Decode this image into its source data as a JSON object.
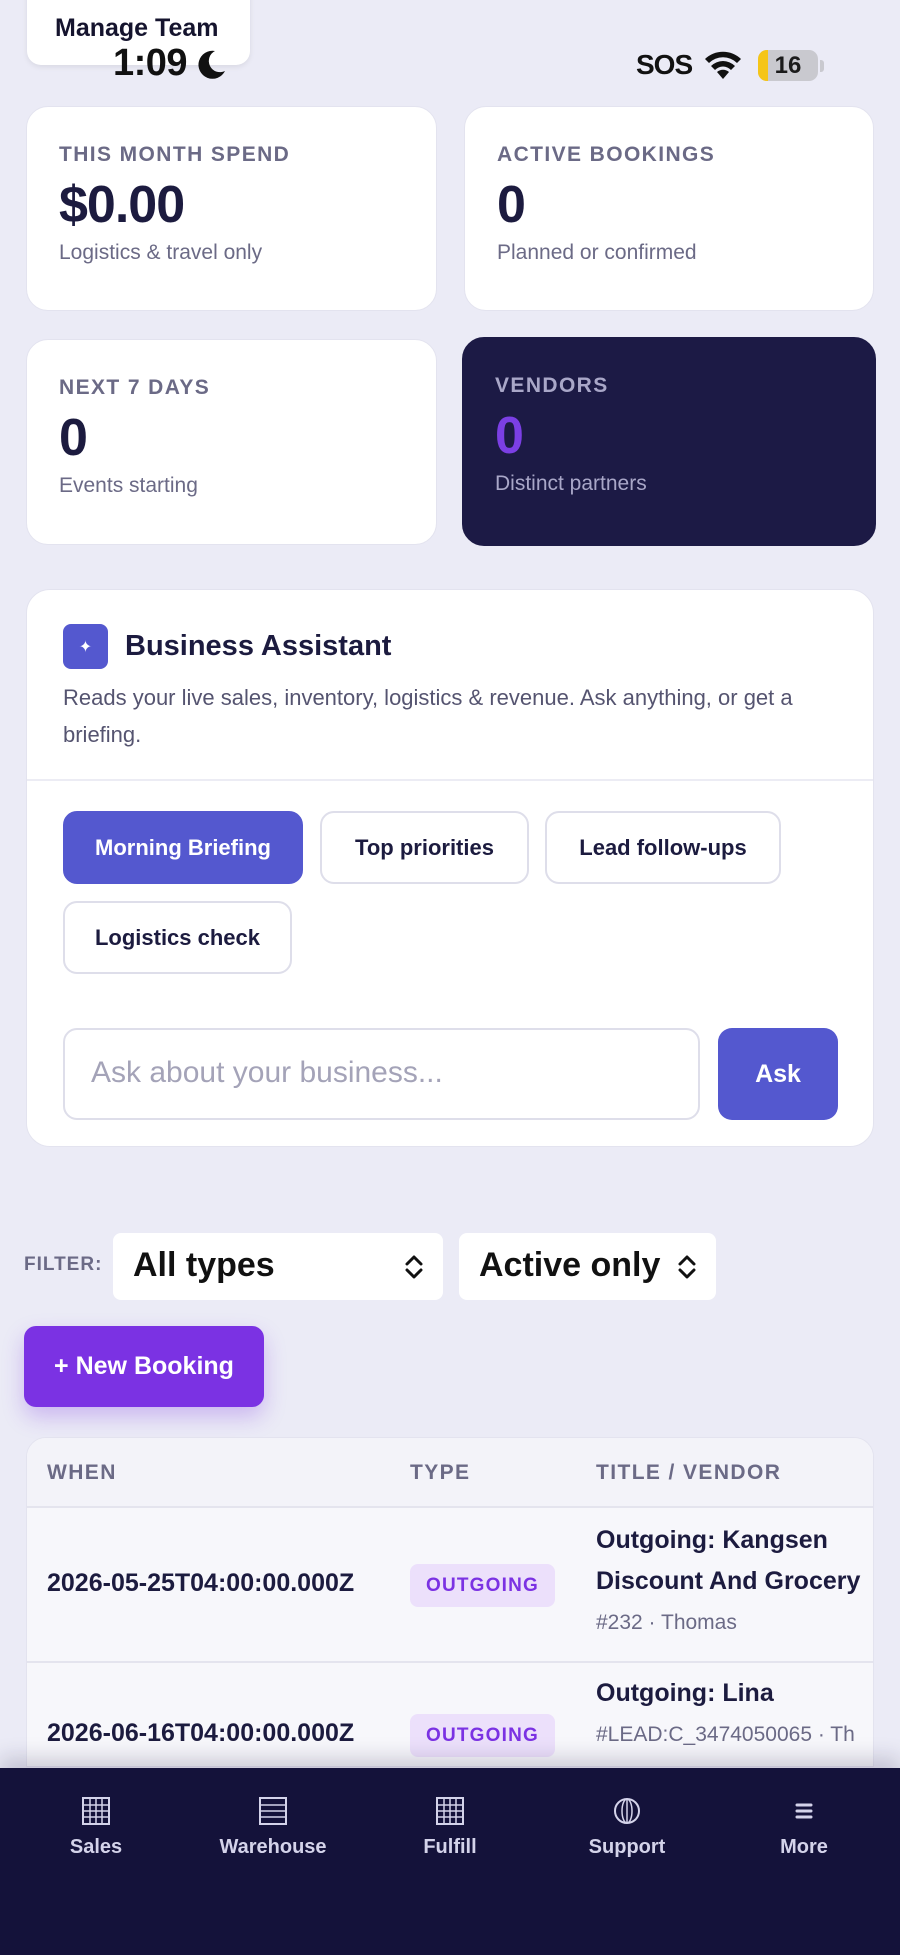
{
  "status_bar": {
    "time": "1:09",
    "sos": "SOS",
    "battery": "16",
    "battery_level_percent": 16
  },
  "header": {
    "manage_team_label": "Manage Team"
  },
  "stats": [
    {
      "label": "THIS MONTH SPEND",
      "value": "$0.00",
      "sub": "Logistics & travel only"
    },
    {
      "label": "ACTIVE BOOKINGS",
      "value": "0",
      "sub": "Planned or confirmed"
    },
    {
      "label": "NEXT 7 DAYS",
      "value": "0",
      "sub": "Events starting"
    },
    {
      "label": "VENDORS",
      "value": "0",
      "sub": "Distinct partners"
    }
  ],
  "assistant": {
    "icon": "sparkle-icon",
    "title": "Business Assistant",
    "description": "Reads your live sales, inventory, logistics & revenue. Ask anything, or get a briefing.",
    "chips": [
      "Morning Briefing",
      "Top priorities",
      "Lead follow-ups",
      "Logistics check"
    ],
    "input_placeholder": "Ask about your business...",
    "ask_label": "Ask"
  },
  "filters": {
    "label": "FILTER:",
    "type_value": "All types",
    "status_value": "Active only"
  },
  "new_booking_label": "+ New Booking",
  "table": {
    "headers": [
      "WHEN",
      "TYPE",
      "TITLE / VENDOR"
    ],
    "rows": [
      {
        "when": "2026-05-25T04:00:00.000Z",
        "type": "OUTGOING",
        "title": "Outgoing: Kangsen Discount And Grocery",
        "meta": "#232 · Thomas"
      },
      {
        "when": "2026-06-16T04:00:00.000Z",
        "type": "OUTGOING",
        "title": "Outgoing: Lina",
        "meta": "#LEAD:C_3474050065 · Th"
      }
    ]
  },
  "bottom_nav": [
    {
      "label": "Sales",
      "icon": "grid-icon"
    },
    {
      "label": "Warehouse",
      "icon": "list-icon"
    },
    {
      "label": "Fulfill",
      "icon": "grid-icon"
    },
    {
      "label": "Support",
      "icon": "globe-icon"
    },
    {
      "label": "More",
      "icon": "menu-icon"
    }
  ],
  "colors": {
    "accent": "#5458cf",
    "purple": "#7b32e3",
    "dark_card": "#1c1a45",
    "nav_background": "#14123a",
    "page_background": "#ebebf6"
  }
}
